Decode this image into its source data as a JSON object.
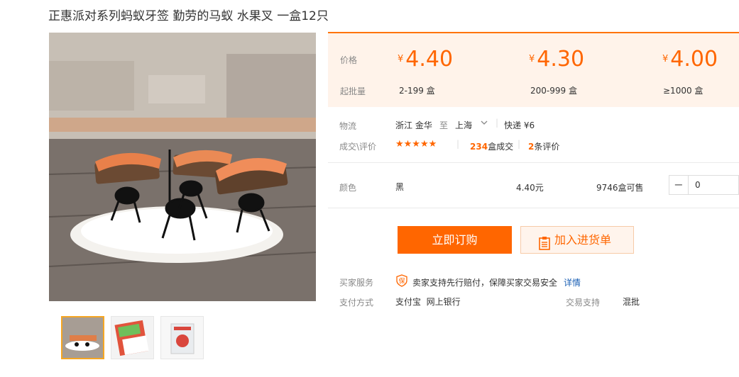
{
  "product": {
    "title": "正惠派对系列蚂蚁牙签 勤劳的马蚁 水果叉 一盒12只"
  },
  "price_panel": {
    "price_label": "价格",
    "batch_label": "起批量",
    "tiers": [
      {
        "currency": "¥",
        "price": "4.40",
        "batch": "2-199 盒"
      },
      {
        "currency": "¥",
        "price": "4.30",
        "batch": "200-999 盒"
      },
      {
        "currency": "¥",
        "price": "4.00",
        "batch": "≥1000 盒"
      }
    ],
    "accent_color": "#ff6600"
  },
  "logistics": {
    "label": "物流",
    "from": "浙江 金华",
    "to_word": "至",
    "to": "上海",
    "express": "快递 ¥6"
  },
  "deals": {
    "label": "成交\\评价",
    "stars": "★★★★★",
    "sold_count": "234",
    "sold_text": "盒成交",
    "review_count": "2",
    "review_text": "条评价"
  },
  "variant": {
    "label": "颜色",
    "color": "黑",
    "price": "4.40元",
    "stock": "9746盒可售",
    "minus": "−",
    "quantity": "0"
  },
  "actions": {
    "buy_label": "立即订购",
    "cart_label": "加入进货单"
  },
  "service": {
    "label": "买家服务",
    "badge": "保",
    "text": "卖家支持先行赔付，保障买家交易安全",
    "link": "详情"
  },
  "payment": {
    "label": "支付方式",
    "methods": "支付宝  网上银行",
    "trade_label": "交易支持",
    "trade_value": "混批"
  }
}
